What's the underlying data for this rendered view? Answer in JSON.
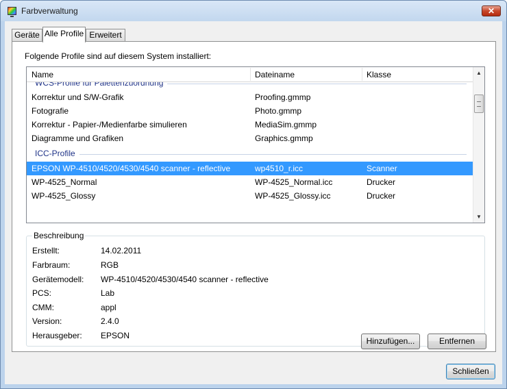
{
  "window": {
    "title": "Farbverwaltung",
    "close_glyph": "✕"
  },
  "tabs": [
    {
      "label": "Geräte"
    },
    {
      "label": "Alle Profile"
    },
    {
      "label": "Erweitert"
    }
  ],
  "profiles": {
    "intro": "Folgende Profile sind auf diesem System installiert:",
    "columns": {
      "name": "Name",
      "file": "Dateiname",
      "class": "Klasse"
    },
    "groups": [
      {
        "label": "WCS-Profile für Palettenzuordnung"
      },
      {
        "label": "ICC-Profile"
      }
    ],
    "rows": [
      {
        "name": "Korrektur und S/W-Grafik",
        "file": "Proofing.gmmp",
        "class": ""
      },
      {
        "name": "Fotografie",
        "file": "Photo.gmmp",
        "class": ""
      },
      {
        "name": "Korrektur - Papier-/Medienfarbe simulieren",
        "file": "MediaSim.gmmp",
        "class": ""
      },
      {
        "name": "Diagramme und Grafiken",
        "file": "Graphics.gmmp",
        "class": ""
      },
      {
        "name": "EPSON WP-4510/4520/4530/4540 scanner - reflective",
        "file": "wp4510_r.icc",
        "class": "Scanner",
        "selected": true
      },
      {
        "name": "WP-4525_Normal",
        "file": "WP-4525_Normal.icc",
        "class": "Drucker"
      },
      {
        "name": "WP-4525_Glossy",
        "file": "WP-4525_Glossy.icc",
        "class": "Drucker"
      }
    ]
  },
  "description": {
    "title": "Beschreibung",
    "props": [
      {
        "label": "Erstellt:",
        "value": "14.02.2011"
      },
      {
        "label": "Farbraum:",
        "value": "RGB"
      },
      {
        "label": "Gerätemodell:",
        "value": "WP-4510/4520/4530/4540 scanner - reflective"
      },
      {
        "label": "PCS:",
        "value": "Lab"
      },
      {
        "label": "CMM:",
        "value": "appl"
      },
      {
        "label": "Version:",
        "value": "2.4.0"
      },
      {
        "label": "Herausgeber:",
        "value": "EPSON"
      }
    ]
  },
  "buttons": {
    "add": "Hinzufügen...",
    "remove": "Entfernen",
    "close": "Schließen"
  },
  "icons": {
    "app": "color-management-icon",
    "close": "close-icon",
    "scroll_up": "scroll-up-arrow-icon",
    "scroll_down": "scroll-down-arrow-icon",
    "up_glyph": "▲",
    "down_glyph": "▼"
  },
  "colors": {
    "selection": "#3399ff",
    "group_header": "#1e3287",
    "window_frame": "#bcd3ec"
  }
}
